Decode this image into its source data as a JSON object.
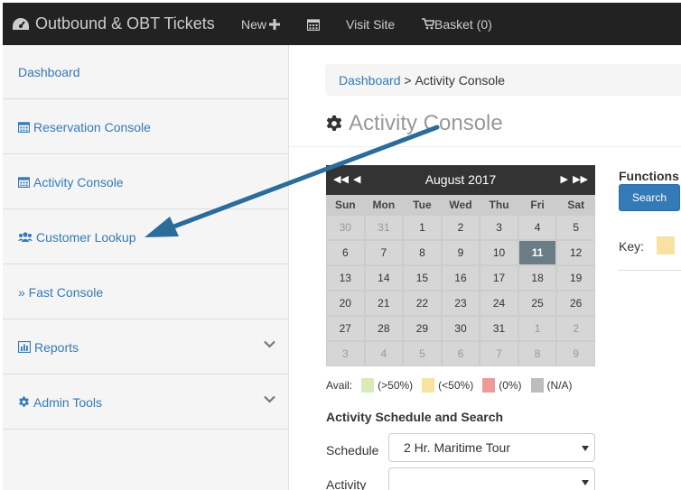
{
  "navbar": {
    "brand": "Outbound & OBT Tickets",
    "new_label": "New",
    "visit_site": "Visit Site",
    "basket": "Basket (0)"
  },
  "sidebar": {
    "items": [
      {
        "label": "Dashboard",
        "icon": "none"
      },
      {
        "label": "Reservation Console",
        "icon": "calendar-icon"
      },
      {
        "label": "Activity Console",
        "icon": "calendar-icon"
      },
      {
        "label": "Customer Lookup",
        "icon": "users-icon"
      },
      {
        "label": "» Fast Console",
        "icon": "none"
      },
      {
        "label": "Reports",
        "icon": "bar-chart-icon"
      },
      {
        "label": "Admin Tools",
        "icon": "gear-icon"
      }
    ]
  },
  "breadcrumb": {
    "root": "Dashboard",
    "separator": " > ",
    "current": "Activity Console"
  },
  "page_title": "Activity Console",
  "calendar": {
    "month": "August 2017",
    "days_of_week": [
      "Sun",
      "Mon",
      "Tue",
      "Wed",
      "Thu",
      "Fri",
      "Sat"
    ],
    "days": [
      {
        "n": "30",
        "other": true
      },
      {
        "n": "31",
        "other": true
      },
      {
        "n": "1"
      },
      {
        "n": "2"
      },
      {
        "n": "3"
      },
      {
        "n": "4"
      },
      {
        "n": "5"
      },
      {
        "n": "6"
      },
      {
        "n": "7"
      },
      {
        "n": "8"
      },
      {
        "n": "9"
      },
      {
        "n": "10"
      },
      {
        "n": "11",
        "today": true
      },
      {
        "n": "12"
      },
      {
        "n": "13"
      },
      {
        "n": "14"
      },
      {
        "n": "15"
      },
      {
        "n": "16"
      },
      {
        "n": "17"
      },
      {
        "n": "18"
      },
      {
        "n": "19"
      },
      {
        "n": "20"
      },
      {
        "n": "21"
      },
      {
        "n": "22"
      },
      {
        "n": "23"
      },
      {
        "n": "24"
      },
      {
        "n": "25"
      },
      {
        "n": "26"
      },
      {
        "n": "27"
      },
      {
        "n": "28"
      },
      {
        "n": "29"
      },
      {
        "n": "30"
      },
      {
        "n": "31"
      },
      {
        "n": "1",
        "other": true
      },
      {
        "n": "2",
        "other": true
      },
      {
        "n": "3",
        "other": true
      },
      {
        "n": "4",
        "other": true
      },
      {
        "n": "5",
        "other": true
      },
      {
        "n": "6",
        "other": true
      },
      {
        "n": "7",
        "other": true
      },
      {
        "n": "8",
        "other": true
      },
      {
        "n": "9",
        "other": true
      }
    ]
  },
  "legend": {
    "label": "Avail:",
    "items": [
      {
        "text": "(>50%)",
        "color": "#d9ecb8"
      },
      {
        "text": "(<50%)",
        "color": "#f7e2a1"
      },
      {
        "text": "(0%)",
        "color": "#ef9a9a"
      },
      {
        "text": "(N/A)",
        "color": "#bdbdbd"
      }
    ]
  },
  "schedule_section": {
    "title": "Activity Schedule and Search",
    "schedule_label": "Schedule",
    "schedule_value": "2 Hr. Maritime Tour",
    "activity_label": "Activity",
    "activity_value": ""
  },
  "functions": {
    "title": "Functions",
    "search_label": "Search",
    "key_label": "Key:",
    "key_color": "#f7e2a1"
  },
  "colors": {
    "navbar_bg": "#222222",
    "link": "#337ab7",
    "arrow": "#2a6c9a"
  }
}
